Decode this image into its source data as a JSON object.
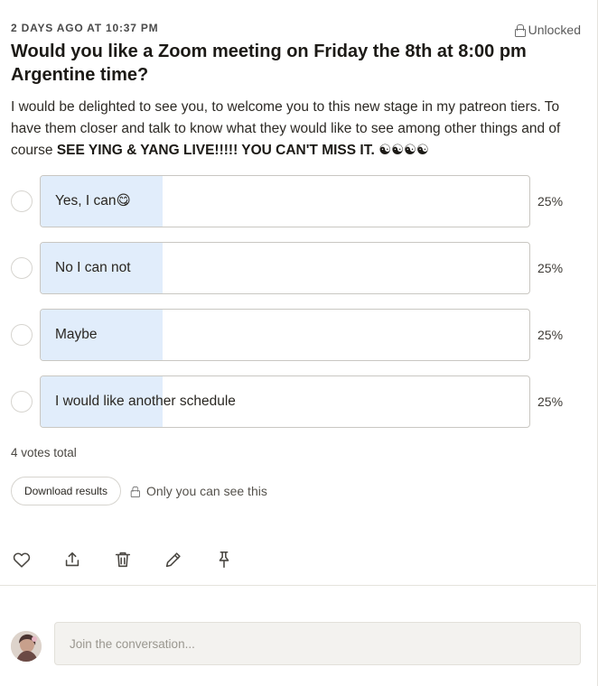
{
  "post": {
    "timestamp": "2 DAYS AGO AT 10:37 PM",
    "lock_status": "Unlocked",
    "title": "Would you like a Zoom meeting on Friday the 8th at 8:00 pm Argentine time?",
    "body_intro": "I would be delighted to see you, to welcome you to this new stage in my patreon tiers. To have them closer and talk to know what they would like to see among other things and of course ",
    "body_emphasis": "SEE YING & YANG LIVE!!!!! YOU CAN'T MISS IT. ☯☯☯☯"
  },
  "poll": {
    "options": [
      {
        "label": "Yes, I can😋",
        "percent_text": "25%",
        "fraction": 0.25
      },
      {
        "label": "No I can not",
        "percent_text": "25%",
        "fraction": 0.25
      },
      {
        "label": "Maybe",
        "percent_text": "25%",
        "fraction": 0.25
      },
      {
        "label": "I would like another schedule",
        "percent_text": "25%",
        "fraction": 0.25
      }
    ],
    "votes_total": "4 votes total",
    "download_label": "Download results",
    "visibility_note": "Only you can see this",
    "fill_color": "#e1edfb"
  },
  "actions": {
    "icons": [
      "heart-icon",
      "share-icon",
      "trash-icon",
      "pencil-icon",
      "pin-icon"
    ]
  },
  "comment": {
    "placeholder": "Join the conversation..."
  }
}
